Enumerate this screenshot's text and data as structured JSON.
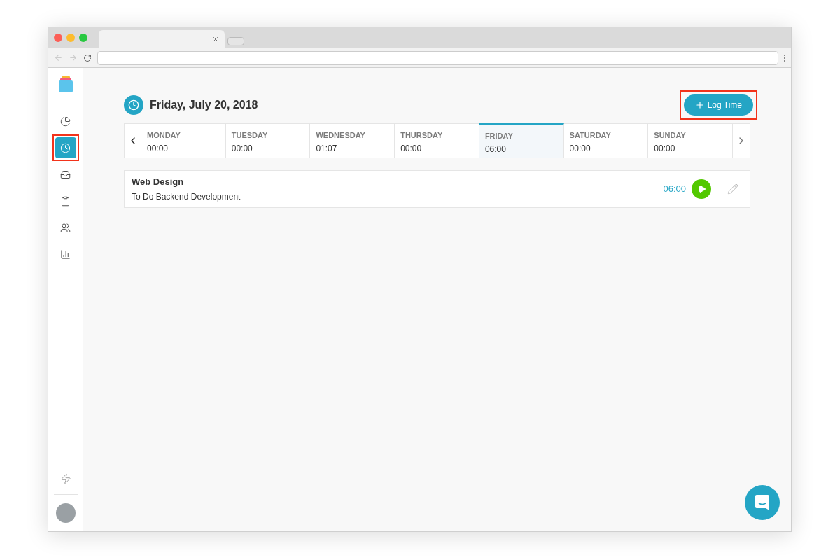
{
  "sidebar": {
    "items": [
      {
        "selected": false,
        "highlighted": false
      },
      {
        "selected": true,
        "highlighted": true
      },
      {
        "selected": false,
        "highlighted": false
      },
      {
        "selected": false,
        "highlighted": false
      },
      {
        "selected": false,
        "highlighted": false
      },
      {
        "selected": false,
        "highlighted": false
      }
    ]
  },
  "header": {
    "date": "Friday, July 20, 2018",
    "log_button": {
      "label": "Log Time",
      "highlighted": true
    }
  },
  "week": [
    {
      "day": "MONDAY",
      "time": "00:00",
      "selected": false
    },
    {
      "day": "TUESDAY",
      "time": "00:00",
      "selected": false
    },
    {
      "day": "WEDNESDAY",
      "time": "01:07",
      "selected": false
    },
    {
      "day": "THURSDAY",
      "time": "00:00",
      "selected": false
    },
    {
      "day": "FRIDAY",
      "time": "06:00",
      "selected": true
    },
    {
      "day": "SATURDAY",
      "time": "00:00",
      "selected": false
    },
    {
      "day": "SUNDAY",
      "time": "00:00",
      "selected": false
    }
  ],
  "entries": [
    {
      "project": "Web Design",
      "task": "To Do Backend Development",
      "time": "06:00"
    }
  ]
}
